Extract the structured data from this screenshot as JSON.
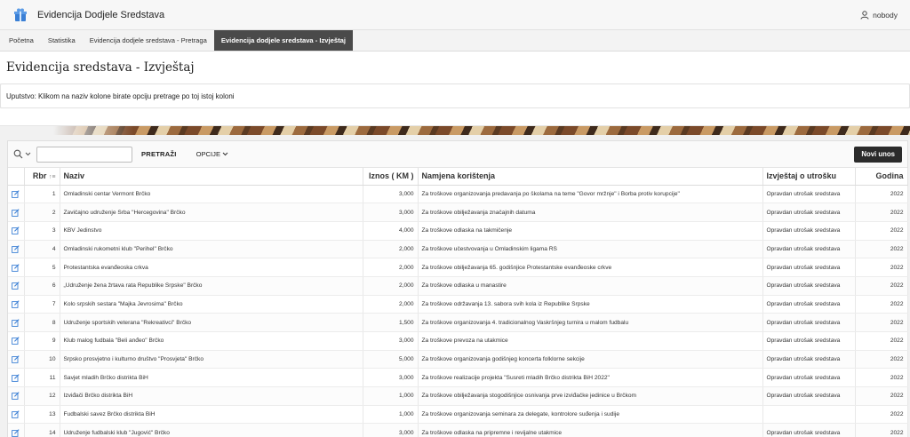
{
  "header": {
    "app_title": "Evidencija Dodjele Sredstava",
    "user_name": "nobody"
  },
  "nav": {
    "tabs": [
      {
        "label": "Početna"
      },
      {
        "label": "Statistika"
      },
      {
        "label": "Evidencija dodjele sredstava - Pretraga"
      },
      {
        "label": "Evidencija dodjele sredstava - Izvještaj"
      }
    ]
  },
  "page": {
    "title": "Evidencija sredstava - Izvještaj",
    "instructions": "Uputstvo: Klikom na naziv kolone birate opciju pretrage po toj istoj koloni"
  },
  "toolbar": {
    "search_value": "",
    "search_label": "PRETRAŽI",
    "actions_label": "OPCIJE",
    "new_label": "Novi unos"
  },
  "table": {
    "columns": {
      "rbr": "Rbr",
      "naziv": "Naziv",
      "iznos": "Iznos ( KM )",
      "namjena": "Namjena korištenja",
      "izvjestaj": "Izvještaj o utrošku",
      "godina": "Godina"
    },
    "rows": [
      {
        "rbr": "1",
        "naziv": "Omladinski centar Vermont Brčko",
        "iznos": "3,000",
        "namjena": "Za troškove organizovanja predavanja po školama na teme \"Govor mržnje\" i Borba protiv korupcije\"",
        "izvjestaj": "Opravdan utrošak sredstava",
        "godina": "2022"
      },
      {
        "rbr": "2",
        "naziv": "Zavičajno udruženje Srba \"Hercegovina\" Brčko",
        "iznos": "3,000",
        "namjena": "Za troškove obilježavanja značajnih datuma",
        "izvjestaj": "Opravdan utrošak sredstava",
        "godina": "2022"
      },
      {
        "rbr": "3",
        "naziv": "KBV Jedinstvo",
        "iznos": "4,000",
        "namjena": "Za troškove odlaska na takmičenje",
        "izvjestaj": "Opravdan utrošak sredstava",
        "godina": "2022"
      },
      {
        "rbr": "4",
        "naziv": "Omladinski rukometni klub \"Perihel\" Brčko",
        "iznos": "2,000",
        "namjena": "Za troškove učestvovanja u Omladinskim ligama RS",
        "izvjestaj": "Opravdan utrošak sredstava",
        "godina": "2022"
      },
      {
        "rbr": "5",
        "naziv": "Protestantska evanđeoska crkva",
        "iznos": "2,000",
        "namjena": "Za troškove obilježavanja 65. godišnjice Protestantske evanđeoske crkve",
        "izvjestaj": "Opravdan utrošak sredstava",
        "godina": "2022"
      },
      {
        "rbr": "6",
        "naziv": "„Udruženje žena žrtava rata Republike Srpske\" Brčko",
        "iznos": "2,000",
        "namjena": "Za troškove odlaska u manastire",
        "izvjestaj": "Opravdan utrošak sredstava",
        "godina": "2022"
      },
      {
        "rbr": "7",
        "naziv": "Kolo srpskih sestara \"Majka Jevrosima\" Brčko",
        "iznos": "2,000",
        "namjena": "Za troškove održavanja 13. sabora svih kola iz Republike Srpske",
        "izvjestaj": "Opravdan utrošak sredstava",
        "godina": "2022"
      },
      {
        "rbr": "8",
        "naziv": "Udruženje sportskih veterana \"Rekreativci\" Brčko",
        "iznos": "1,500",
        "namjena": "Za troškove organizovanja 4. tradicionalnog Vaskršnjeg turnira u malom fudbalu",
        "izvjestaj": "Opravdan utrošak sredstava",
        "godina": "2022"
      },
      {
        "rbr": "9",
        "naziv": "Klub malog fudbala \"Beli anđeo\" Brčko",
        "iznos": "3,000",
        "namjena": "Za troškove prevoza na utakmice",
        "izvjestaj": "Opravdan utrošak sredstava",
        "godina": "2022"
      },
      {
        "rbr": "10",
        "naziv": "Srpsko prosvjetno i kulturno društvo \"Prosvjeta\" Brčko",
        "iznos": "5,000",
        "namjena": "Za troškove organizovanja godišnjeg koncerta folklorne sekcije",
        "izvjestaj": "Opravdan utrošak sredstava",
        "godina": "2022"
      },
      {
        "rbr": "11",
        "naziv": "Savjet mladih Brčko distrikta BiH",
        "iznos": "3,000",
        "namjena": "Za troškove realizacije projekta \"Susreti mladih Brčko distrikta BiH 2022\"",
        "izvjestaj": "Opravdan utrošak sredstava",
        "godina": "2022"
      },
      {
        "rbr": "12",
        "naziv": "Izviđači Brčko distrikta BiH",
        "iznos": "1,000",
        "namjena": "Za troškove obilježavanja stogodišnjice osnivanja prve izviđačke jedinice u Brčkom",
        "izvjestaj": "Opravdan utrošak sredstava",
        "godina": "2022"
      },
      {
        "rbr": "13",
        "naziv": "Fudbalski savez Brčko distrikta BiH",
        "iznos": "1,000",
        "namjena": "Za troškove organizovanja seminara za delegate, kontrolore suđenja i sudije",
        "izvjestaj": "",
        "godina": "2022"
      },
      {
        "rbr": "14",
        "naziv": "Udruženje fudbalski klub \"Jugović\" Brčko",
        "iznos": "3,000",
        "namjena": "Za troškove odlaska na pripremne i revijalne utakmice",
        "izvjestaj": "Opravdan utrošak sredstava",
        "godina": "2022"
      }
    ]
  }
}
